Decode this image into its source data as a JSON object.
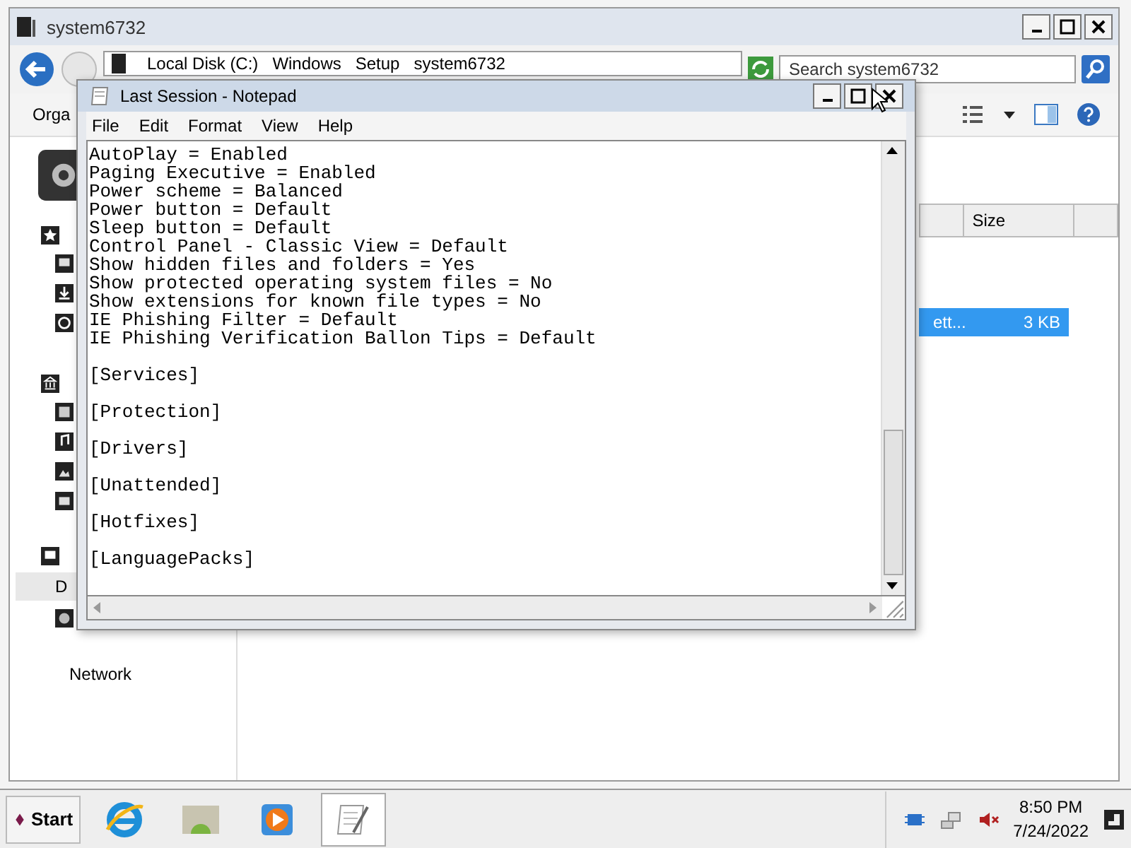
{
  "explorer": {
    "title": "system6732",
    "breadcrumb": [
      "Local Disk (C:)",
      "Windows",
      "Setup",
      "system6732"
    ],
    "search": {
      "placeholder": "Search system6732"
    },
    "toolbar_label": "Orga",
    "sidebar": {
      "items": [
        {
          "label": "D",
          "selected": true
        },
        {
          "label": "Network",
          "selected": false
        }
      ]
    },
    "columns": [
      {
        "label": "Size"
      }
    ],
    "rows": [
      {
        "name": "ett...",
        "size": "3 KB",
        "selected": true
      }
    ]
  },
  "notepad": {
    "title": "Last Session - Notepad",
    "menu": [
      "File",
      "Edit",
      "Format",
      "View",
      "Help"
    ],
    "lines": [
      "AutoPlay = Enabled",
      "Paging Executive = Enabled",
      "Power scheme = Balanced",
      "Power button = Default",
      "Sleep button = Default",
      "Control Panel - Classic View = Default",
      "Show hidden files and folders = Yes",
      "Show protected operating system files = No",
      "Show extensions for known file types = No",
      "IE Phishing Filter = Default",
      "IE Phishing Verification Ballon Tips = Default"
    ],
    "sections": [
      "[Services]",
      "[Protection]",
      "[Drivers]",
      "[Unattended]",
      "[Hotfixes]",
      "[LanguagePacks]"
    ]
  },
  "taskbar": {
    "start": "Start",
    "apps": [
      {
        "kind": "browser",
        "selected": false
      },
      {
        "kind": "photos",
        "selected": false
      },
      {
        "kind": "media",
        "selected": false
      },
      {
        "kind": "notepad",
        "selected": true
      }
    ],
    "time": "8:50 PM",
    "date": "7/24/2022"
  }
}
